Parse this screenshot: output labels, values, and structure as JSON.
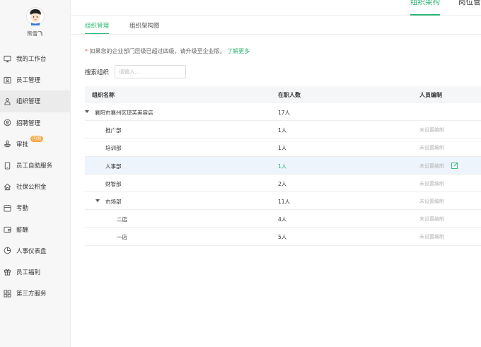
{
  "user": {
    "name": "熊雪飞"
  },
  "sidebar": {
    "items": [
      {
        "label": "我的工作台",
        "icon": "monitor-icon",
        "active": false
      },
      {
        "label": "员工管理",
        "icon": "id-card-icon",
        "active": false
      },
      {
        "label": "组织管理",
        "icon": "org-person-icon",
        "active": true
      },
      {
        "label": "招聘管理",
        "icon": "search-person-icon",
        "active": false
      },
      {
        "label": "审批",
        "icon": "stamp-icon",
        "active": false,
        "badge": "内测"
      },
      {
        "label": "员工自助服务",
        "icon": "phone-icon",
        "active": false
      },
      {
        "label": "社保公积金",
        "icon": "house-icon",
        "active": false
      },
      {
        "label": "考勤",
        "icon": "calendar-icon",
        "active": false
      },
      {
        "label": "薪酬",
        "icon": "wallet-icon",
        "active": false
      },
      {
        "label": "人事仪表盘",
        "icon": "pie-chart-icon",
        "active": false
      },
      {
        "label": "员工福利",
        "icon": "gift-icon",
        "active": false
      },
      {
        "label": "第三方服务",
        "icon": "grid-icon",
        "active": false
      }
    ]
  },
  "topbar": {
    "tabs": [
      {
        "label": "组织架构",
        "active": true
      },
      {
        "label": "岗位管理",
        "active": false
      }
    ]
  },
  "subtabs": [
    {
      "label": "组织管理",
      "active": true
    },
    {
      "label": "组织架构图",
      "active": false
    }
  ],
  "notice": {
    "star": "*",
    "text": "如果您的企业部门层级已超过四级，请升级至企业版。",
    "link": "了解更多"
  },
  "search": {
    "label": "搜索组织",
    "placeholder": "请输入...",
    "value": ""
  },
  "table": {
    "headers": {
      "name": "组织名称",
      "count": "在职人数",
      "staffing": "人员编制"
    },
    "rows": [
      {
        "name": "襄阳市襄州区琼芙美容店",
        "count": "17人",
        "staffing": "",
        "level": 0,
        "expanded": true
      },
      {
        "name": "推广部",
        "count": "1人",
        "staffing": "未设置编制",
        "level": 1
      },
      {
        "name": "培训部",
        "count": "1人",
        "staffing": "未设置编制",
        "level": 1
      },
      {
        "name": "人事部",
        "count": "1人",
        "staffing": "未设置编制",
        "level": 1,
        "highlight": true
      },
      {
        "name": "财智部",
        "count": "2人",
        "staffing": "未设置编制",
        "level": 1
      },
      {
        "name": "市场部",
        "count": "11人",
        "staffing": "未设置编制",
        "level": 1,
        "expanded": true
      },
      {
        "name": "二店",
        "count": "4人",
        "staffing": "未设置编制",
        "level": 2
      },
      {
        "name": "一店",
        "count": "5人",
        "staffing": "未设置编制",
        "level": 2
      }
    ]
  },
  "colors": {
    "accent": "#2cb673",
    "badge": "#f7a94a",
    "highlight_row": "#eef4fc"
  }
}
